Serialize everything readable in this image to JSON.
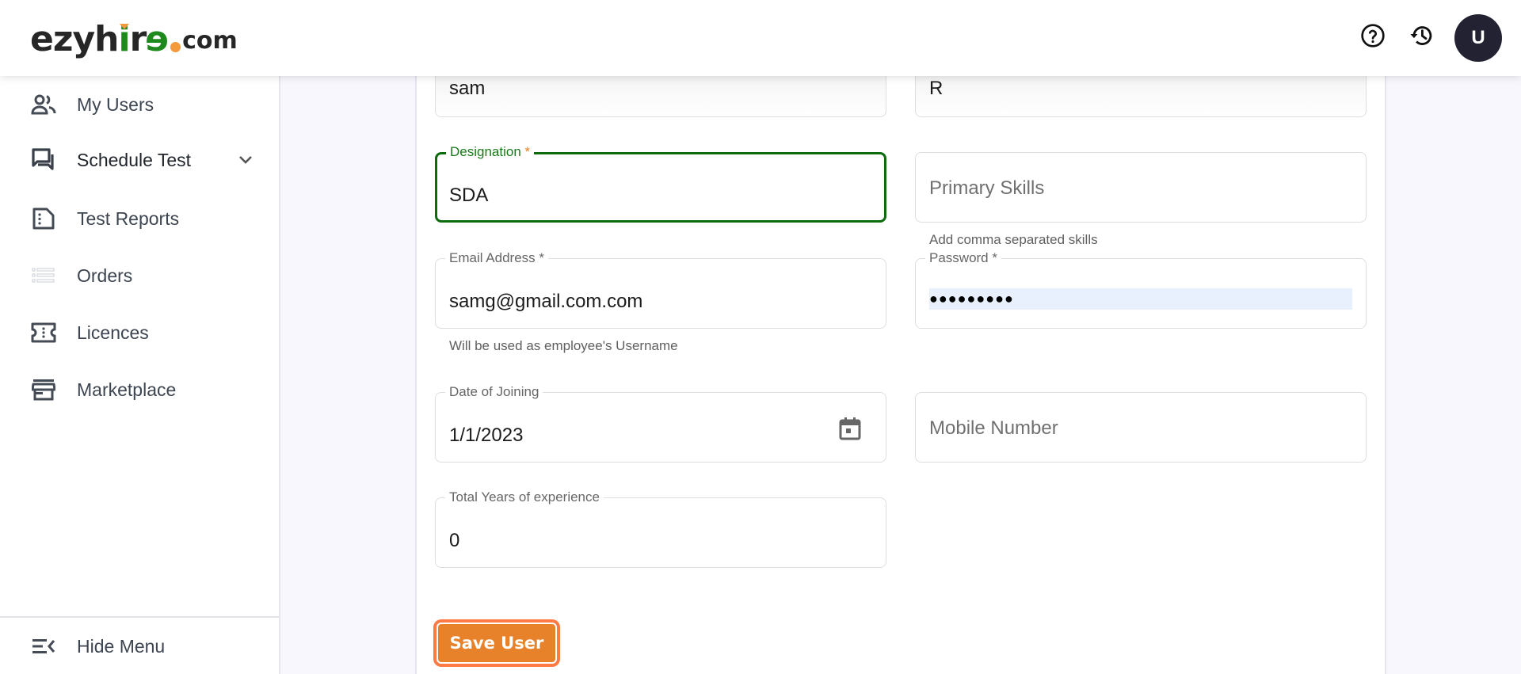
{
  "header": {
    "logo": {
      "part1": "ezyh",
      "part2": "i",
      "part3": "r",
      "part4": "e",
      "part5": "com"
    },
    "icons": [
      "help-icon",
      "history-icon"
    ],
    "avatar_initial": "U"
  },
  "sidebar": {
    "items": [
      {
        "label": "My Users",
        "icon": "users-icon"
      },
      {
        "label": "Schedule Test",
        "icon": "forum-icon",
        "expandable": true
      },
      {
        "label": "Test Reports",
        "icon": "report-icon"
      },
      {
        "label": "Orders",
        "icon": "list-icon"
      },
      {
        "label": "Licences",
        "icon": "ticket-icon"
      },
      {
        "label": "Marketplace",
        "icon": "store-icon"
      }
    ],
    "hide_menu_label": "Hide Menu"
  },
  "form": {
    "first_name": {
      "value": "sam"
    },
    "last_name": {
      "value": "R"
    },
    "designation": {
      "label": "Designation",
      "required_mark": "*",
      "value": "SDA"
    },
    "primary_skills": {
      "placeholder": "Primary Skills",
      "helper": "Add comma separated skills"
    },
    "email": {
      "label": "Email Address *",
      "value": "samg@gmail.com.com",
      "helper": "Will be used as employee's Username"
    },
    "password": {
      "label": "Password *",
      "masked_value": "●●●●●●●●●"
    },
    "date_of_joining": {
      "label": "Date of Joining",
      "value": "1/1/2023"
    },
    "mobile_number": {
      "placeholder": "Mobile Number"
    },
    "total_experience": {
      "label": "Total Years of experience",
      "value": "0"
    },
    "save_label": "Save User"
  },
  "colors": {
    "accent_orange": "#e8822a",
    "focus_green": "#0d6b0d",
    "avatar_bg": "#222233",
    "background": "#f7f7fd"
  }
}
